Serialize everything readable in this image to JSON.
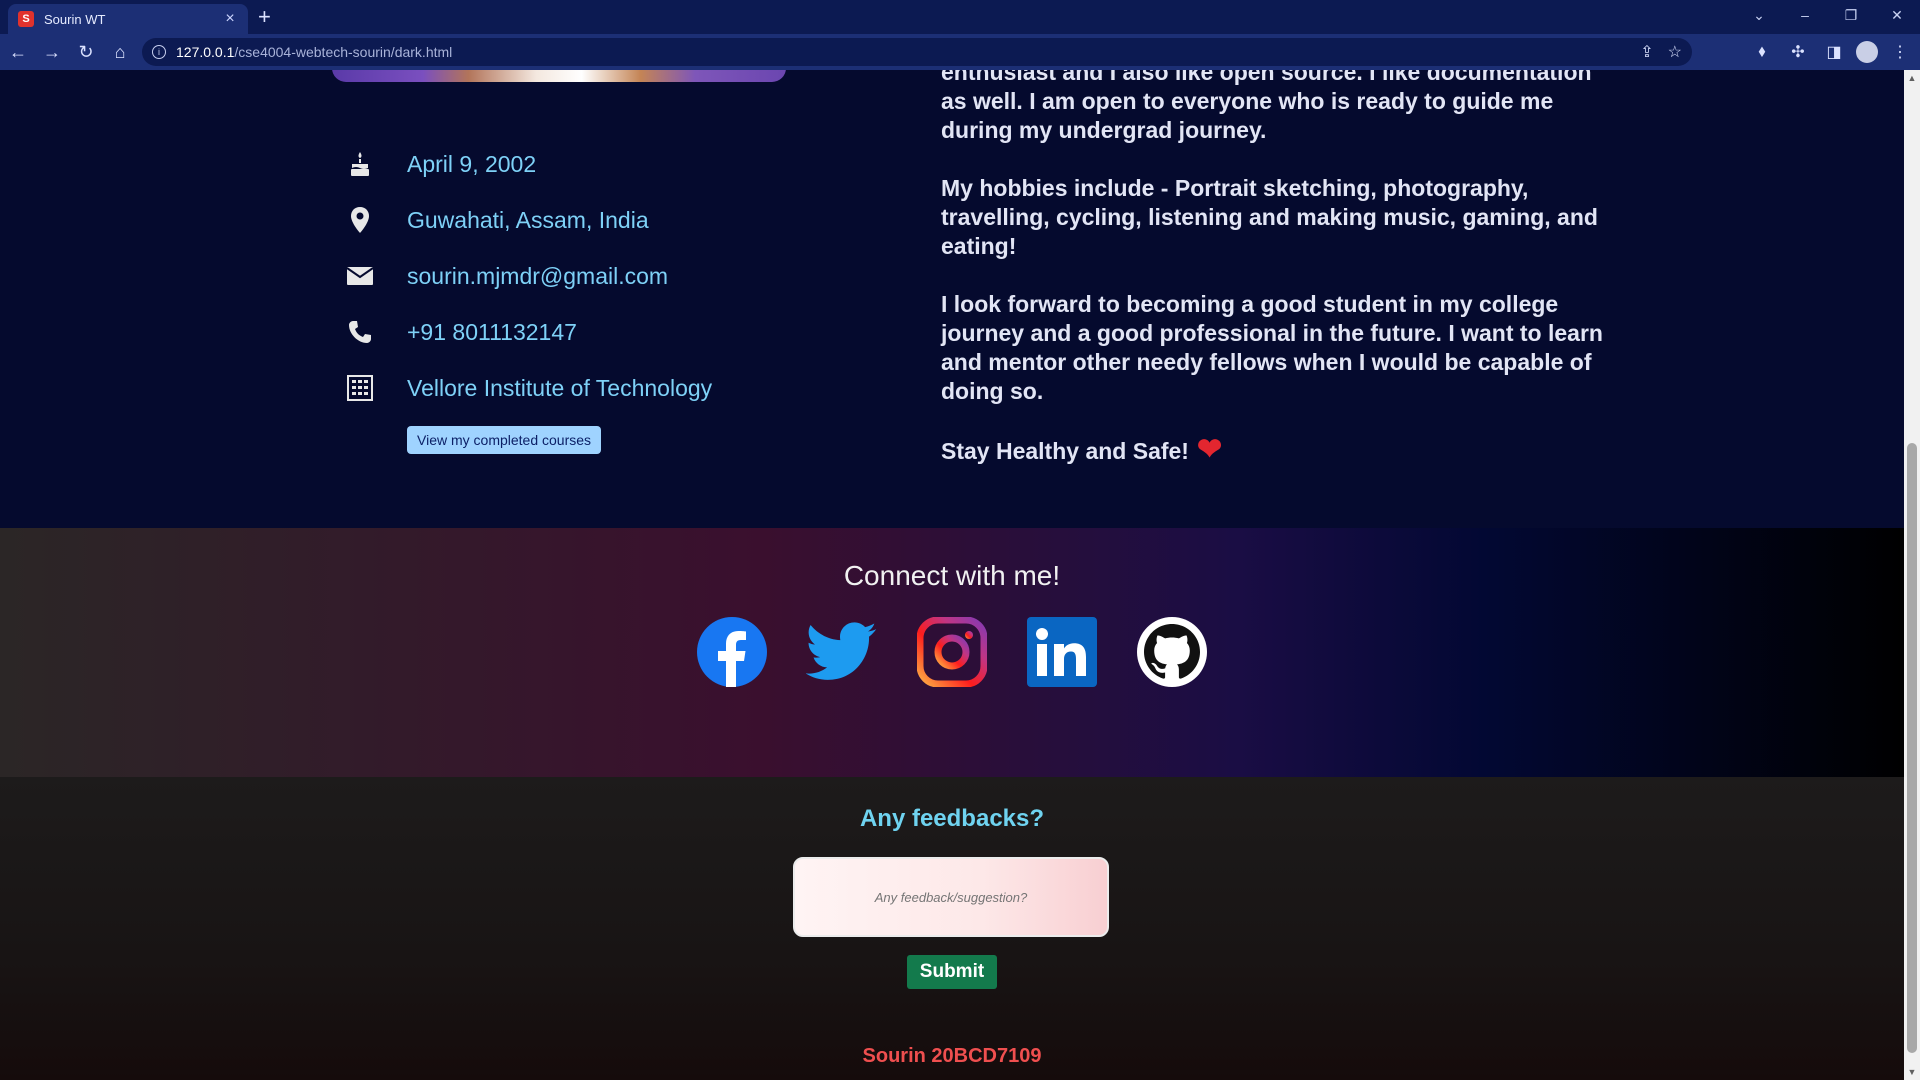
{
  "browser": {
    "tab_title": "Sourin WT",
    "tab_favicon_letter": "S",
    "tab_close": "×",
    "new_tab": "+",
    "url_host": "127.0.0.1",
    "url_path": "/cse4004-webtech-sourin/dark.html"
  },
  "about": {
    "info": [
      {
        "icon": "birthday-cake-icon",
        "text": "April 9, 2002"
      },
      {
        "icon": "location-pin-icon",
        "text": "Guwahati, Assam, India"
      },
      {
        "icon": "envelope-icon",
        "text": "sourin.mjmdr@gmail.com"
      },
      {
        "icon": "phone-icon",
        "text": "+91 8011132147"
      },
      {
        "icon": "building-icon",
        "text": "Vellore Institute of Technology"
      }
    ],
    "courses_button": "View my completed courses",
    "bio": [
      "enthusiast and I also like open source. I like documentation as well. I am open to everyone who is ready to guide me during my undergrad journey.",
      "My hobbies include - Portrait sketching, photography, travelling, cycling, listening and making music, gaming, and eating!",
      "I look forward to becoming a good student in my college journey and a good professional in the future. I want to learn and mentor other needy fellows when I would be capable of doing so."
    ],
    "closing": "Stay Healthy and Safe!",
    "closing_emoji": "❤"
  },
  "connect": {
    "title": "Connect with me!",
    "socials": [
      "facebook-icon",
      "twitter-icon",
      "instagram-icon",
      "linkedin-icon",
      "github-icon"
    ]
  },
  "feedback": {
    "title": "Any feedbacks?",
    "placeholder": "Any feedback/suggestion?",
    "submit": "Submit",
    "signature": "Sourin 20BCD7109"
  },
  "colors": {
    "page_bg": "#050a2e",
    "info_text": "#7ed1f7",
    "submit_bg": "#137a4c",
    "signature": "#ef4f4f",
    "feedback_title": "#6fd3f0"
  }
}
